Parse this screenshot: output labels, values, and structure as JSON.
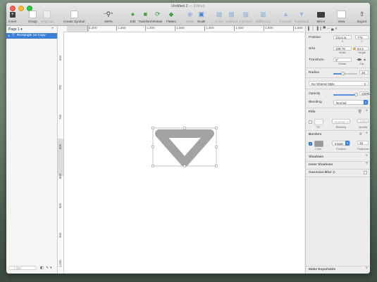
{
  "window": {
    "title": "Untitled 2",
    "title_status": "— Edited"
  },
  "toolbar": {
    "items": [
      {
        "label": "Insert",
        "icon": "insert-icon",
        "enabled": true
      },
      {
        "label": "Group",
        "icon": "group-icon",
        "enabled": true
      },
      {
        "label": "Ungroup",
        "icon": "ungroup-icon",
        "enabled": false
      },
      {
        "label": "Create Symbol",
        "icon": "create-symbol-icon",
        "enabled": true
      },
      {
        "label": "400%",
        "icon": "zoom-icon",
        "enabled": true
      },
      {
        "label": "Edit",
        "icon": "edit-icon",
        "enabled": true
      },
      {
        "label": "Transform",
        "icon": "transform-icon",
        "enabled": true
      },
      {
        "label": "Rotate",
        "icon": "rotate-icon",
        "enabled": true
      },
      {
        "label": "Flatten",
        "icon": "flatten-icon",
        "enabled": true
      },
      {
        "label": "Mask",
        "icon": "mask-icon",
        "enabled": false
      },
      {
        "label": "Scale",
        "icon": "scale-icon",
        "enabled": true
      },
      {
        "label": "Union",
        "icon": "union-icon",
        "enabled": false
      },
      {
        "label": "Subtract",
        "icon": "subtract-icon",
        "enabled": false
      },
      {
        "label": "Intersect",
        "icon": "intersect-icon",
        "enabled": false
      },
      {
        "label": "Difference",
        "icon": "difference-icon",
        "enabled": false
      },
      {
        "label": "Forward",
        "icon": "forward-icon",
        "enabled": false
      },
      {
        "label": "Backward",
        "icon": "backward-icon",
        "enabled": false
      },
      {
        "label": "Mirror",
        "icon": "mirror-icon",
        "enabled": true
      },
      {
        "label": "View",
        "icon": "view-icon",
        "enabled": true
      },
      {
        "label": "Export",
        "icon": "export-icon",
        "enabled": true
      }
    ]
  },
  "layers": {
    "page_label": "Page 1",
    "selected_layer": "Rectangle 15 Copy",
    "filter_placeholder": "Filter"
  },
  "rulers": {
    "top": [
      "1,200",
      "1,250",
      "1,300",
      "1,350",
      "1,400",
      "1,450",
      "1,500",
      "1,550"
    ],
    "left": [
      "650",
      "700",
      "750",
      "800",
      "850",
      "900",
      "950",
      "1,000"
    ]
  },
  "inspector": {
    "position": {
      "label": "Position",
      "x": "1314.11",
      "y": "770",
      "x_label": "X",
      "y_label": "Y"
    },
    "size": {
      "label": "Size",
      "width": "109.78",
      "height": "64.5",
      "width_label": "Width",
      "height_label": "Height"
    },
    "transform": {
      "label": "Transform",
      "rotate": "0°",
      "rotate_label": "Rotate",
      "flip_label": "Flip"
    },
    "radius": {
      "label": "Radius",
      "value": "20",
      "level": 0.4
    },
    "shared_style": "No Shared Style",
    "opacity": {
      "label": "Opacity",
      "value": "100%",
      "level": 1.0
    },
    "blending": {
      "label": "Blending",
      "value": "Normal"
    },
    "fills": {
      "title": "Fills",
      "blending": "Normal",
      "opacity": "100%",
      "fill_label": "Fill",
      "blending_label": "Blending",
      "opacity_label": "Opacity"
    },
    "borders": {
      "title": "Borders",
      "position": "Inside",
      "thickness": "15",
      "color_label": "Color",
      "position_label": "Position",
      "thickness_label": "Thickness",
      "color": "#9a9a9a"
    },
    "shadows": "Shadows",
    "inner_shadows": "Inner Shadows",
    "gaussian_blur": "Gaussian Blur ◇",
    "make_exportable": "Make Exportable"
  },
  "colors": {
    "accent": "#3b7fdb",
    "shape_stroke": "#a3a3a3"
  }
}
